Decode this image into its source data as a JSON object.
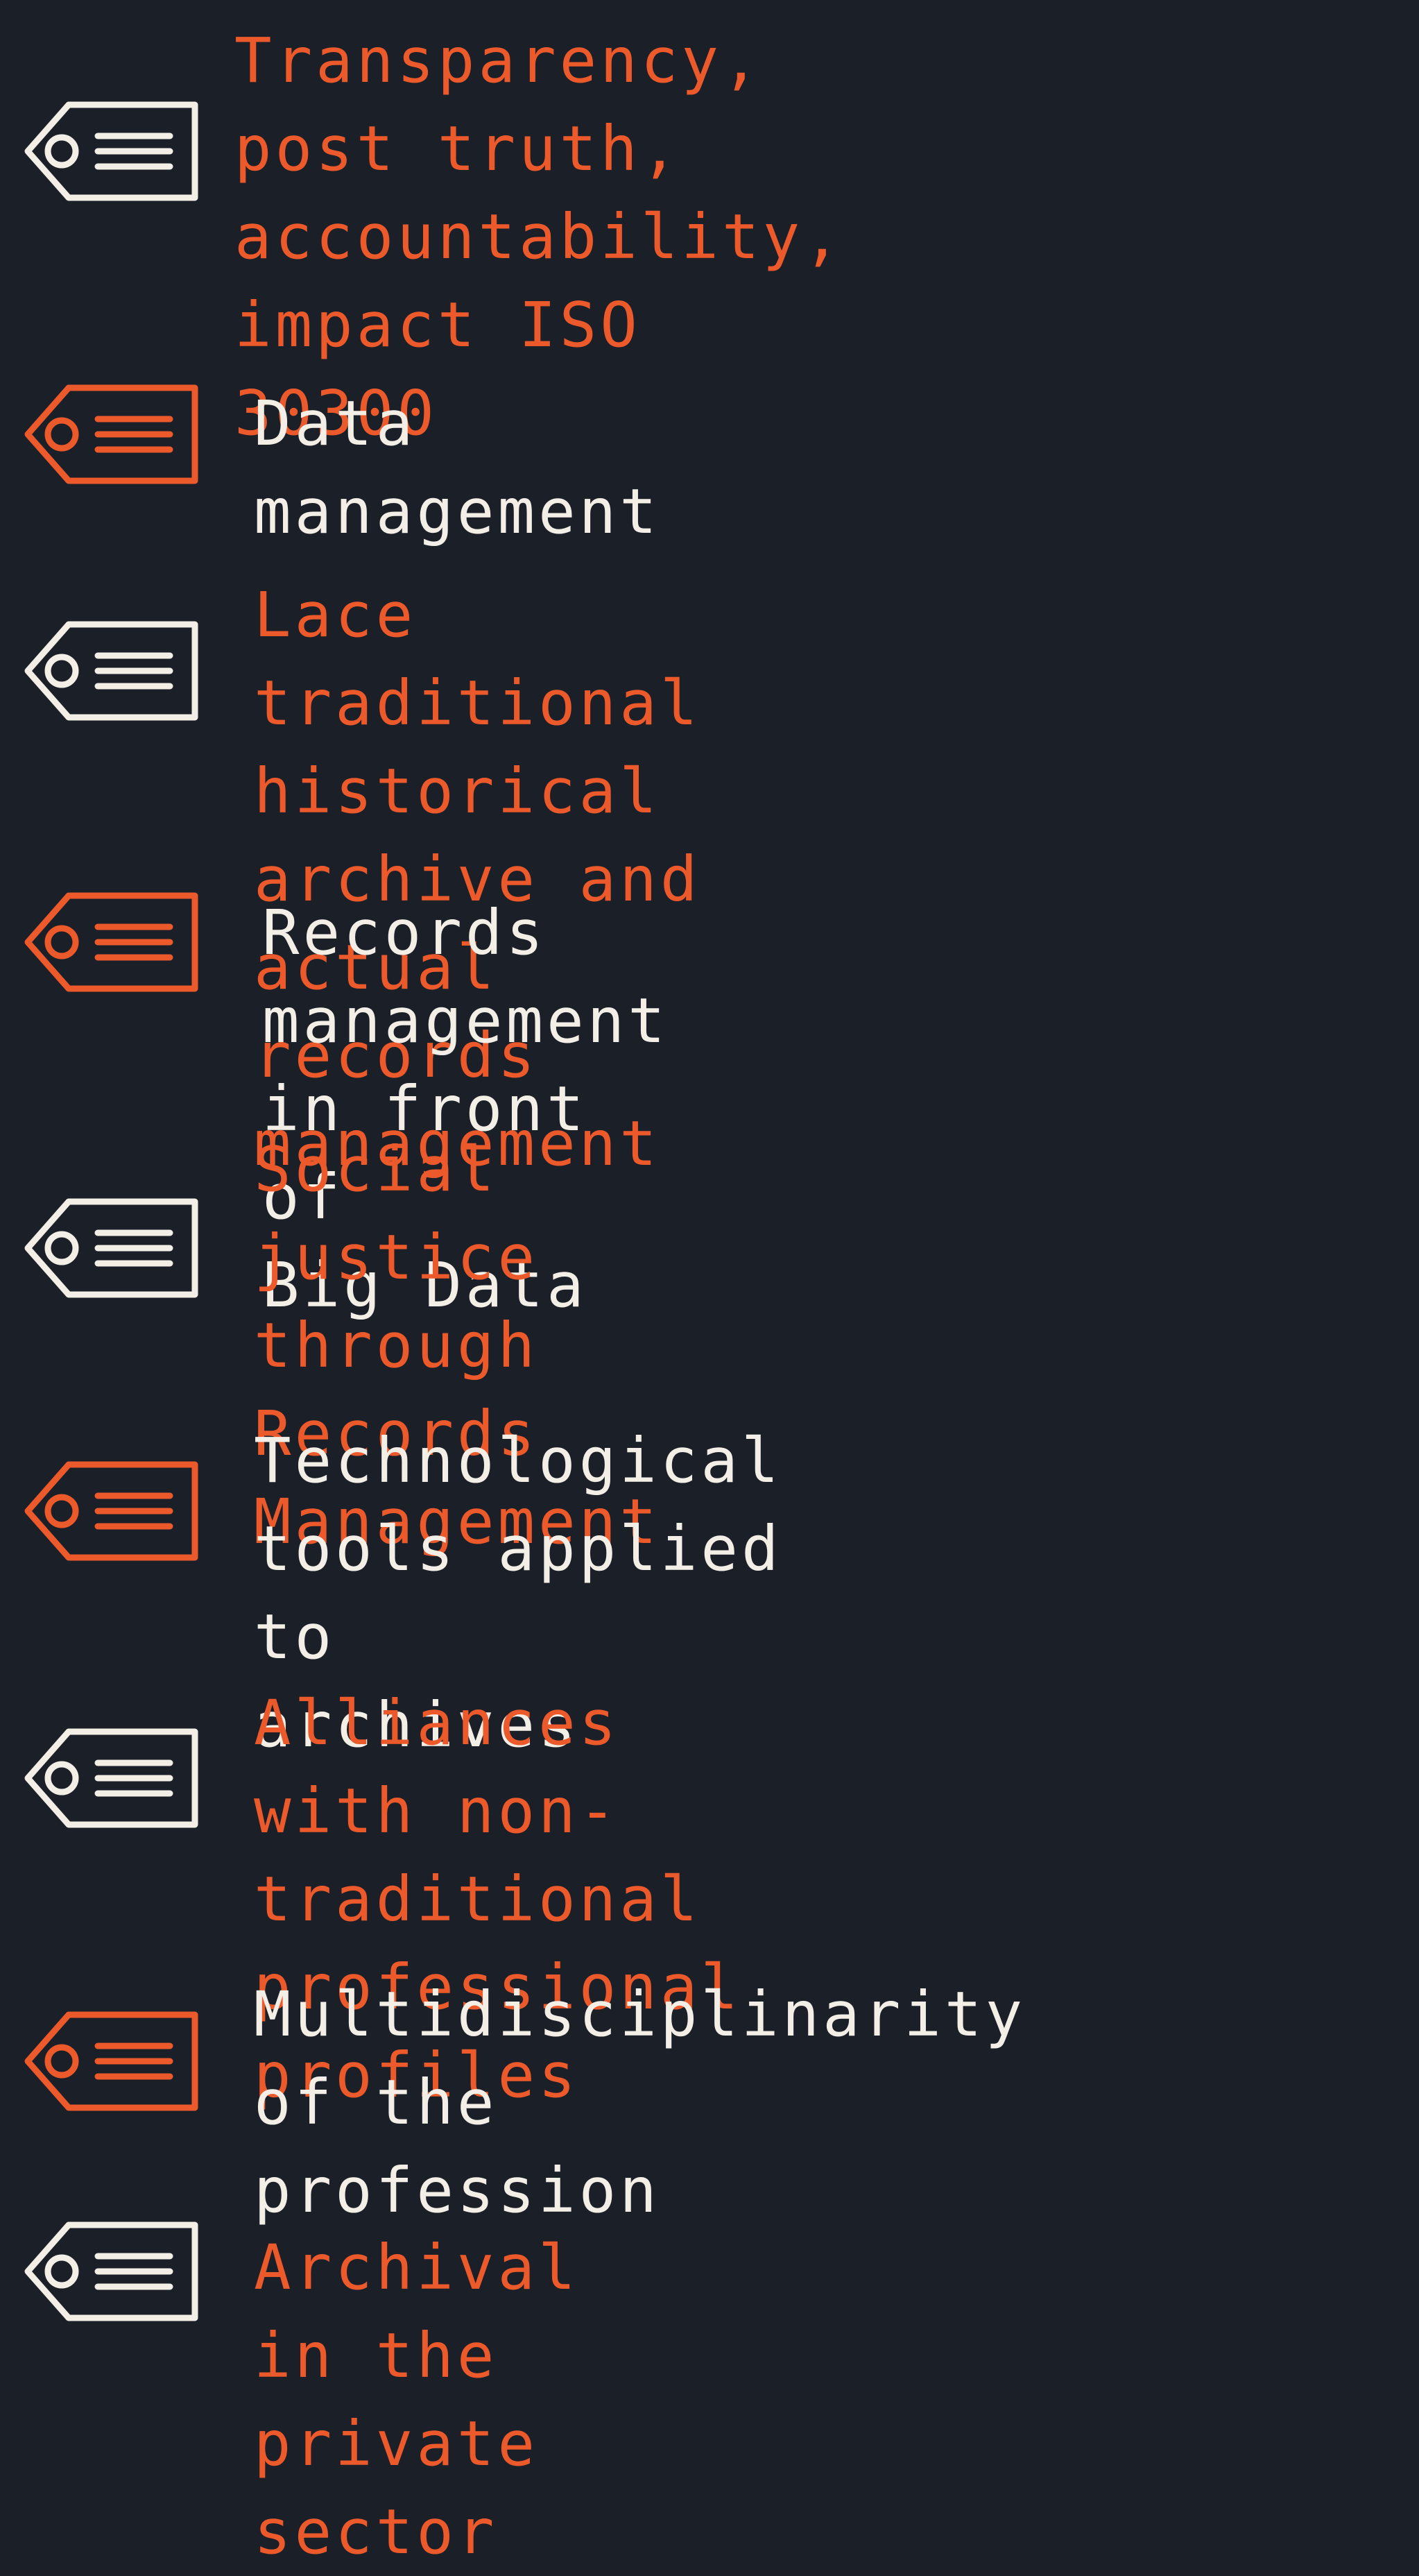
{
  "colors": {
    "background": "#1b1f27",
    "orange": "#ec5a2c",
    "white": "#f3eee6"
  },
  "items": [
    {
      "icon": "price-tag-icon",
      "icon_color": "white",
      "text_color": "orange",
      "text": "Transparency, post truth,\naccountability, impact ISO\n30300"
    },
    {
      "icon": "price-tag-icon",
      "icon_color": "orange",
      "text_color": "white",
      "text": "Data management"
    },
    {
      "icon": "price-tag-icon",
      "icon_color": "white",
      "text_color": "orange",
      "text": "Lace traditional historical\narchive and actual records\nmanagement"
    },
    {
      "icon": "price-tag-icon",
      "icon_color": "orange",
      "text_color": "white",
      "text": "Records management in front of\nBig Data"
    },
    {
      "icon": "price-tag-icon",
      "icon_color": "white",
      "text_color": "orange",
      "text": "Social justice through Records\nManagement"
    },
    {
      "icon": "price-tag-icon",
      "icon_color": "orange",
      "text_color": "white",
      "text": "Technological tools applied to\narchives"
    },
    {
      "icon": "price-tag-icon",
      "icon_color": "white",
      "text_color": "orange",
      "text": "Alliances with non-traditional\nprofessional profiles"
    },
    {
      "icon": "price-tag-icon",
      "icon_color": "orange",
      "text_color": "white",
      "text": "Multidisciplinarity of the\nprofession"
    },
    {
      "icon": "price-tag-icon",
      "icon_color": "white",
      "text_color": "orange",
      "text": "Archival in the private sector"
    }
  ]
}
